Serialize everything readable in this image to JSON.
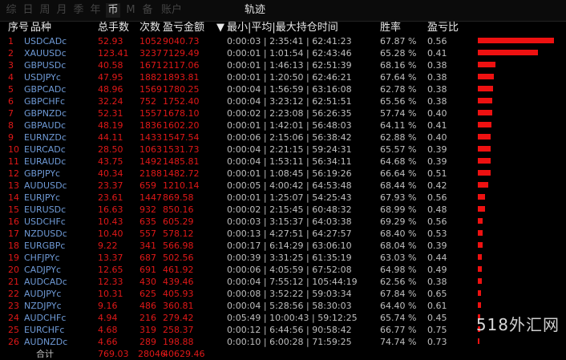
{
  "tabs": [
    {
      "label": "综"
    },
    {
      "label": "日"
    },
    {
      "label": "周"
    },
    {
      "label": "月"
    },
    {
      "label": "季"
    },
    {
      "label": "年"
    },
    {
      "label": "币"
    },
    {
      "label": "M"
    },
    {
      "label": "备"
    },
    {
      "label": "账户"
    }
  ],
  "center_tab": "轨迹",
  "headers": {
    "idx": "序号",
    "symbol": "品种",
    "total_lots": "总手数",
    "count": "次数",
    "profit": "盈亏金额",
    "sort_marker": "▼",
    "timing": "最小|平均|最大持仓时间",
    "winrate": "胜率",
    "pl_ratio": "盈亏比"
  },
  "rows": [
    {
      "idx": "1",
      "symbol": "USDCADc",
      "total_lots": "52.93",
      "count": "1052",
      "profit": "9040.73",
      "timing": "0:00:03 | 2:35:41 | 62:41:23",
      "winrate": "67.87 %",
      "pl_ratio": "0.56",
      "bar": 9040.73
    },
    {
      "idx": "2",
      "symbol": "XAUUSDc",
      "total_lots": "123.41",
      "count": "3237",
      "profit": "7129.49",
      "timing": "0:00:01 | 1:01:54 | 62:43:46",
      "winrate": "65.28 %",
      "pl_ratio": "0.41",
      "bar": 7129.49
    },
    {
      "idx": "3",
      "symbol": "GBPUSDc",
      "total_lots": "40.58",
      "count": "1671",
      "profit": "2117.06",
      "timing": "0:00:01 | 1:46:13 | 62:51:39",
      "winrate": "68.16 %",
      "pl_ratio": "0.38",
      "bar": 2117.06
    },
    {
      "idx": "4",
      "symbol": "USDJPYc",
      "total_lots": "47.95",
      "count": "1882",
      "profit": "1893.81",
      "timing": "0:00:01 | 1:20:50 | 62:46:21",
      "winrate": "67.64 %",
      "pl_ratio": "0.38",
      "bar": 1893.81
    },
    {
      "idx": "5",
      "symbol": "GBPCADc",
      "total_lots": "48.96",
      "count": "1569",
      "profit": "1780.25",
      "timing": "0:00:04 | 1:56:59 | 63:16:08",
      "winrate": "62.78 %",
      "pl_ratio": "0.38",
      "bar": 1780.25
    },
    {
      "idx": "6",
      "symbol": "GBPCHFc",
      "total_lots": "32.24",
      "count": "752",
      "profit": "1752.40",
      "timing": "0:00:04 | 3:23:12 | 62:51:51",
      "winrate": "65.56 %",
      "pl_ratio": "0.38",
      "bar": 1752.4
    },
    {
      "idx": "7",
      "symbol": "GBPNZDc",
      "total_lots": "52.31",
      "count": "1557",
      "profit": "1678.10",
      "timing": "0:00:02 | 2:23:08 | 56:26:35",
      "winrate": "57.74 %",
      "pl_ratio": "0.40",
      "bar": 1678.1
    },
    {
      "idx": "8",
      "symbol": "GBPAUDc",
      "total_lots": "48.19",
      "count": "1836",
      "profit": "1602.20",
      "timing": "0:00:01 | 1:42:01 | 56:48:03",
      "winrate": "64.11 %",
      "pl_ratio": "0.41",
      "bar": 1602.2
    },
    {
      "idx": "9",
      "symbol": "EURNZDc",
      "total_lots": "44.11",
      "count": "1433",
      "profit": "1547.54",
      "timing": "0:00:06 | 2:15:06 | 56:38:42",
      "winrate": "62.88 %",
      "pl_ratio": "0.40",
      "bar": 1547.54
    },
    {
      "idx": "10",
      "symbol": "EURCADc",
      "total_lots": "28.50",
      "count": "1063",
      "profit": "1531.73",
      "timing": "0:00:04 | 2:21:15 | 59:24:31",
      "winrate": "65.57 %",
      "pl_ratio": "0.39",
      "bar": 1531.73
    },
    {
      "idx": "11",
      "symbol": "EURAUDc",
      "total_lots": "43.75",
      "count": "1492",
      "profit": "1485.81",
      "timing": "0:00:04 | 1:53:11 | 56:34:11",
      "winrate": "64.68 %",
      "pl_ratio": "0.39",
      "bar": 1485.81
    },
    {
      "idx": "12",
      "symbol": "GBPJPYc",
      "total_lots": "40.34",
      "count": "2188",
      "profit": "1482.72",
      "timing": "0:00:01 | 1:08:45 | 56:19:26",
      "winrate": "66.64 %",
      "pl_ratio": "0.51",
      "bar": 1482.72
    },
    {
      "idx": "13",
      "symbol": "AUDUSDc",
      "total_lots": "23.37",
      "count": "659",
      "profit": "1210.14",
      "timing": "0:00:05 | 4:00:42 | 64:53:48",
      "winrate": "68.44 %",
      "pl_ratio": "0.42",
      "bar": 1210.14
    },
    {
      "idx": "14",
      "symbol": "EURJPYc",
      "total_lots": "23.61",
      "count": "1447",
      "profit": "869.58",
      "timing": "0:00:01 | 1:25:07 | 54:25:43",
      "winrate": "67.93 %",
      "pl_ratio": "0.56",
      "bar": 869.58
    },
    {
      "idx": "15",
      "symbol": "EURUSDc",
      "total_lots": "16.63",
      "count": "932",
      "profit": "850.16",
      "timing": "0:00:02 | 2:15:45 | 60:48:32",
      "winrate": "68.99 %",
      "pl_ratio": "0.48",
      "bar": 850.16
    },
    {
      "idx": "16",
      "symbol": "USDCHFc",
      "total_lots": "10.43",
      "count": "635",
      "profit": "605.29",
      "timing": "0:00:03 | 3:15:37 | 64:03:38",
      "winrate": "69.29 %",
      "pl_ratio": "0.56",
      "bar": 605.29
    },
    {
      "idx": "17",
      "symbol": "NZDUSDc",
      "total_lots": "10.40",
      "count": "557",
      "profit": "578.12",
      "timing": "0:00:13 | 4:27:51 | 64:27:57",
      "winrate": "68.40 %",
      "pl_ratio": "0.53",
      "bar": 578.12
    },
    {
      "idx": "18",
      "symbol": "EURGBPc",
      "total_lots": "9.22",
      "count": "341",
      "profit": "566.98",
      "timing": "0:00:17 | 6:14:29 | 63:06:10",
      "winrate": "68.04 %",
      "pl_ratio": "0.39",
      "bar": 566.98
    },
    {
      "idx": "19",
      "symbol": "CHFJPYc",
      "total_lots": "13.37",
      "count": "687",
      "profit": "502.56",
      "timing": "0:00:39 | 3:31:25 | 61:35:19",
      "winrate": "63.03 %",
      "pl_ratio": "0.44",
      "bar": 502.56
    },
    {
      "idx": "20",
      "symbol": "CADJPYc",
      "total_lots": "12.65",
      "count": "691",
      "profit": "461.92",
      "timing": "0:00:06 | 4:05:59 | 67:52:08",
      "winrate": "64.98 %",
      "pl_ratio": "0.49",
      "bar": 461.92
    },
    {
      "idx": "21",
      "symbol": "AUDCADc",
      "total_lots": "12.33",
      "count": "430",
      "profit": "439.46",
      "timing": "0:00:04 | 7:55:12 | 105:44:19",
      "winrate": "62.56 %",
      "pl_ratio": "0.38",
      "bar": 439.46
    },
    {
      "idx": "22",
      "symbol": "AUDJPYc",
      "total_lots": "10.31",
      "count": "625",
      "profit": "405.93",
      "timing": "0:00:08 | 3:52:22 | 59:03:34",
      "winrate": "67.84 %",
      "pl_ratio": "0.65",
      "bar": 405.93
    },
    {
      "idx": "23",
      "symbol": "NZDJPYc",
      "total_lots": "9.16",
      "count": "486",
      "profit": "360.81",
      "timing": "0:00:04 | 5:28:56 | 58:30:03",
      "winrate": "64.40 %",
      "pl_ratio": "0.61",
      "bar": 360.81
    },
    {
      "idx": "24",
      "symbol": "AUDCHFc",
      "total_lots": "4.94",
      "count": "216",
      "profit": "279.42",
      "timing": "0:05:49 | 10:00:43 | 59:12:25",
      "winrate": "65.74 %",
      "pl_ratio": "0.45",
      "bar": 279.42
    },
    {
      "idx": "25",
      "symbol": "EURCHFc",
      "total_lots": "4.68",
      "count": "319",
      "profit": "258.37",
      "timing": "0:00:12 | 6:44:56 | 90:58:42",
      "winrate": "66.77 %",
      "pl_ratio": "0.75",
      "bar": 258.37
    },
    {
      "idx": "26",
      "symbol": "AUDNZDc",
      "total_lots": "4.66",
      "count": "289",
      "profit": "198.88",
      "timing": "0:00:10 | 6:00:28 | 71:59:25",
      "winrate": "74.74 %",
      "pl_ratio": "0.73",
      "bar": 198.88
    }
  ],
  "total": {
    "label": "合计",
    "total_lots": "769.03",
    "count": "28046",
    "profit": "40629.46"
  },
  "watermark": {
    "num": "518",
    "text": "外汇网"
  },
  "colors": {
    "index": "#e01818",
    "symbol": "#6f9ad6",
    "value": "#e01818",
    "timing": "#bfbfbf",
    "bar": "#ee1111"
  }
}
